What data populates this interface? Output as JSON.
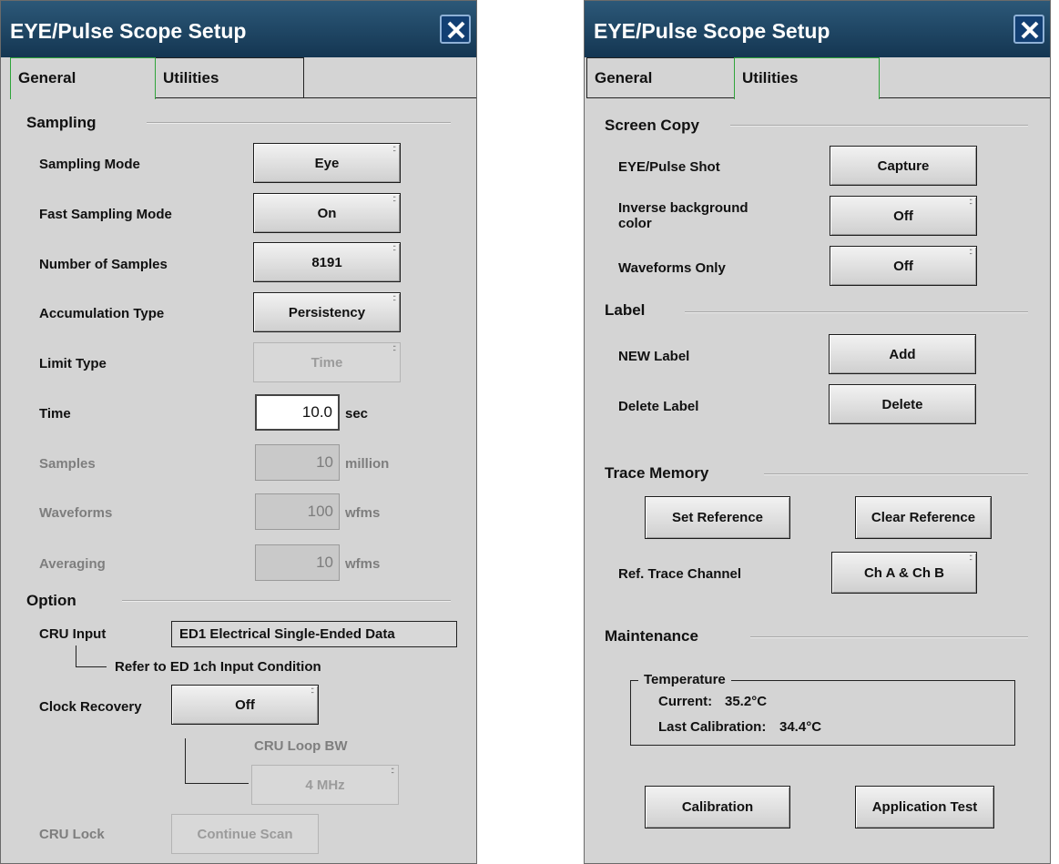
{
  "left": {
    "title": "EYE/Pulse Scope Setup",
    "tabs": {
      "general": "General",
      "utilities": "Utilities"
    },
    "sampling": {
      "section": "Sampling",
      "sampling_mode": {
        "label": "Sampling Mode",
        "value": "Eye"
      },
      "fast_sampling_mode": {
        "label": "Fast Sampling Mode",
        "value": "On"
      },
      "number_of_samples": {
        "label": "Number of Samples",
        "value": "8191"
      },
      "accumulation_type": {
        "label": "Accumulation Type",
        "value": "Persistency"
      },
      "limit_type": {
        "label": "Limit Type",
        "value": "Time"
      },
      "time": {
        "label": "Time",
        "value": "10.0",
        "unit": "sec"
      },
      "samples": {
        "label": "Samples",
        "value": "10",
        "unit": "million"
      },
      "waveforms": {
        "label": "Waveforms",
        "value": "100",
        "unit": "wfms"
      },
      "averaging": {
        "label": "Averaging",
        "value": "10",
        "unit": "wfms"
      }
    },
    "option": {
      "section": "Option",
      "cru_input": {
        "label": "CRU Input",
        "value": "ED1 Electrical Single-Ended Data"
      },
      "refer_note": "Refer to ED 1ch Input Condition",
      "clock_recovery": {
        "label": "Clock Recovery",
        "value": "Off"
      },
      "cru_loop_bw": {
        "label": "CRU Loop BW",
        "value": "4 MHz"
      },
      "cru_lock": {
        "label": "CRU Lock",
        "button": "Continue Scan"
      }
    }
  },
  "right": {
    "title": "EYE/Pulse Scope Setup",
    "tabs": {
      "general": "General",
      "utilities": "Utilities"
    },
    "screen_copy": {
      "section": "Screen Copy",
      "eye_pulse_shot": {
        "label": "EYE/Pulse Shot",
        "button": "Capture"
      },
      "inverse_bg": {
        "label_line1": "Inverse background",
        "label_line2": "color",
        "value": "Off"
      },
      "waveforms_only": {
        "label": "Waveforms Only",
        "value": "Off"
      }
    },
    "label_section": {
      "section": "Label",
      "new_label": {
        "label": "NEW Label",
        "button": "Add"
      },
      "delete_label": {
        "label": "Delete Label",
        "button": "Delete"
      }
    },
    "trace_memory": {
      "section": "Trace Memory",
      "set_reference": "Set Reference",
      "clear_reference": "Clear Reference",
      "ref_trace_channel": {
        "label": "Ref. Trace Channel",
        "value": "Ch A & Ch B"
      }
    },
    "maintenance": {
      "section": "Maintenance",
      "temperature": {
        "title": "Temperature",
        "current_label": "Current:",
        "current_value": "35.2°C",
        "last_cal_label": "Last Calibration:",
        "last_cal_value": "34.4°C"
      },
      "calibration": "Calibration",
      "application_test": "Application Test"
    }
  }
}
